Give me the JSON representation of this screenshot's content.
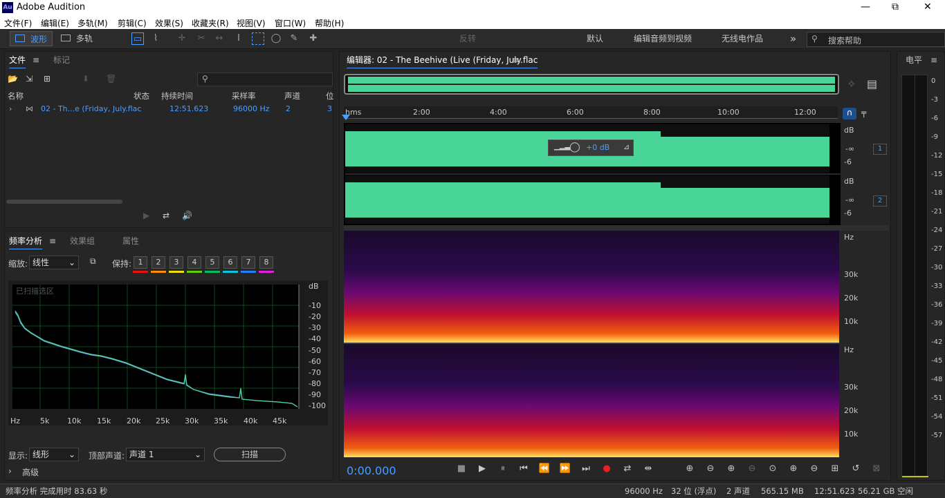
{
  "app": {
    "title": "Adobe Audition",
    "logo": "Au",
    "min": "—",
    "max": "⧉",
    "close": "✕"
  },
  "menu": [
    "文件(F)",
    "编辑(E)",
    "多轨(M)",
    "剪辑(C)",
    "效果(S)",
    "收藏夹(R)",
    "视图(V)",
    "窗口(W)",
    "帮助(H)"
  ],
  "toolbar": {
    "waveform": "波形",
    "multitrack": "多轨",
    "reverse": "反转",
    "workspaces": [
      "默认",
      "编辑音频到视频",
      "无线电作品"
    ],
    "more": "»",
    "search_placeholder": "搜索帮助"
  },
  "files": {
    "tab_files": "文件",
    "tab_markers": "标记",
    "menu": "≡",
    "columns": [
      "名称",
      "状态",
      "持续时间",
      "采样率",
      "声道",
      "位"
    ],
    "row": {
      "name": "02 - Th...e (Friday, July.flac",
      "duration": "12:51.623",
      "rate": "96000 Hz",
      "channels": "2",
      "bits": "3"
    }
  },
  "freq": {
    "tab_freq": "频率分析",
    "tab_fx": "效果组",
    "tab_props": "属性",
    "zoom_label": "缩放:",
    "zoom_value": "线性",
    "hold_label": "保持:",
    "slots": [
      "1",
      "2",
      "3",
      "4",
      "5",
      "6",
      "7",
      "8"
    ],
    "slot_colors": [
      "#e81010",
      "#ff8c00",
      "#f0e000",
      "#60d000",
      "#00c060",
      "#00c8e0",
      "#2080ff",
      "#e020e0"
    ],
    "scanned": "已扫描选区",
    "db_label": "dB",
    "db_ticks": [
      "-10",
      "-20",
      "-30",
      "-40",
      "-50",
      "-60",
      "-70",
      "-80",
      "-90",
      "-100"
    ],
    "hz_ticks": [
      "Hz",
      "5k",
      "10k",
      "15k",
      "20k",
      "25k",
      "30k",
      "35k",
      "40k",
      "45k"
    ],
    "display_label": "显示:",
    "display_value": "线形",
    "channel_label": "顶部声道:",
    "channel_value": "声道 1",
    "scan_button": "扫描",
    "advanced": "高级"
  },
  "editor": {
    "title": "编辑器: 02 - The Beehive (Live (Friday, July.flac",
    "menu": "≡",
    "time_ticks": [
      "hms",
      "2:00",
      "4:00",
      "6:00",
      "8:00",
      "10:00",
      "12:00"
    ],
    "ch_db": "dB",
    "ch_inf": "-∞",
    "ch_m6": "-6",
    "ch1": "1",
    "ch2": "2",
    "volume": "+0 dB",
    "spec_hz": "Hz",
    "spec_ticks": [
      "30k",
      "20k",
      "10k"
    ],
    "time": "0:00.000"
  },
  "level": {
    "title": "电平",
    "ticks": [
      "0",
      "-3",
      "-6",
      "-9",
      "-12",
      "-15",
      "-18",
      "-21",
      "-24",
      "-27",
      "-30",
      "-33",
      "-36",
      "-39",
      "-42",
      "-45",
      "-48",
      "-51",
      "-54",
      "-57"
    ]
  },
  "status": {
    "left": "频率分析 完成用时 83.63 秒",
    "rate": "96000 Hz",
    "bits": "32 位 (浮点)",
    "channels": "2 声道",
    "size": "565.15 MB",
    "duration": "12:51.623",
    "free": "56.21 GB 空闲"
  },
  "colors": {
    "wave": "#48d597",
    "accent": "#4a9eff"
  }
}
